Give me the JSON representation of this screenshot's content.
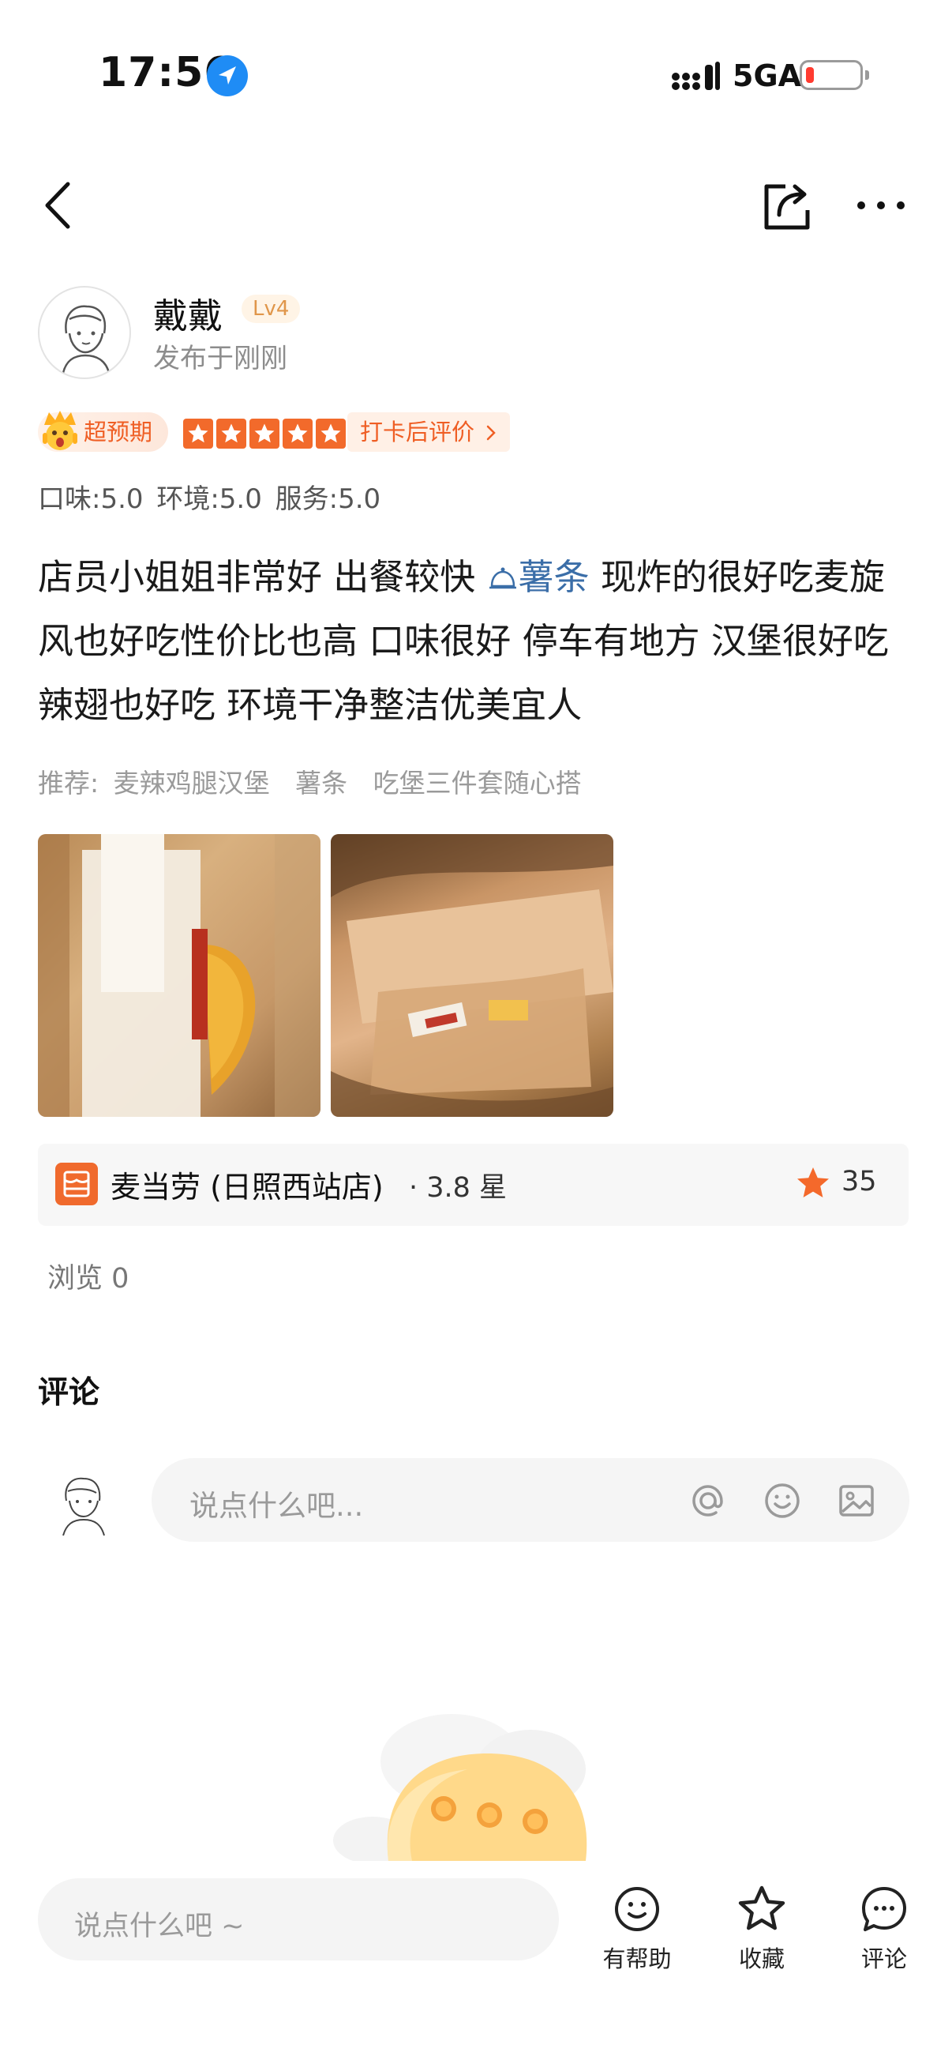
{
  "status_bar": {
    "time": "17:56",
    "network": "5GA",
    "battery_level": 0.1,
    "battery_color": "#ff3b30",
    "location_icon": "location-arrow-icon"
  },
  "nav": {
    "back_icon": "chevron-left-icon",
    "share_icon": "share-icon",
    "more_icon": "more-icon"
  },
  "author": {
    "name": "戴戴",
    "level": "Lv4",
    "posted": "发布于刚刚"
  },
  "rating": {
    "expectation_badge": "超预期",
    "stars": 5,
    "star_color": "#f26a2b",
    "checkin_label": "打卡后评价",
    "scores": "口味:5.0  环境:5.0  服务:5.0"
  },
  "review": {
    "part1": "店员小姐姐非常好 出餐较快 ",
    "tag": "薯条",
    "part2": " 现炸的很好吃麦旋风也好吃性价比也高 口味很好 停车有地方 汉堡很好吃 辣翅也好吃 环境干净整洁优美宜人",
    "tag_color": "#3b6ea8"
  },
  "recommend": {
    "label": "推荐:",
    "items": [
      "麦辣鸡腿汉堡",
      "薯条",
      "吃堡三件套随心搭"
    ]
  },
  "shop": {
    "name": "麦当劳 (日照西站店)",
    "rating": "· 3.8 星",
    "favorites": "35",
    "brand_color": "#f06a2d"
  },
  "views": "浏览 0",
  "comments": {
    "title": "评论",
    "placeholder": "说点什么吧..."
  },
  "bottom_bar": {
    "placeholder": "说点什么吧 ~",
    "helpful_label": "有帮助",
    "collect_label": "收藏",
    "comment_label": "评论"
  }
}
